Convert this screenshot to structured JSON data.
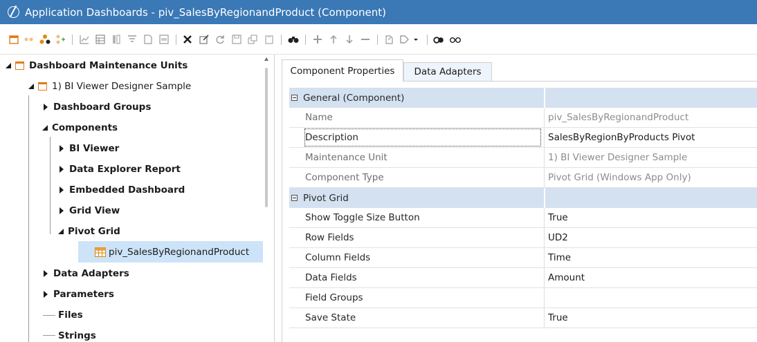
{
  "window": {
    "title": "Application Dashboards - piv_SalesByRegionandProduct (Component)"
  },
  "toolbar": {
    "icons": [
      "create-dashboard-icon",
      "link-icon",
      "group-icon",
      "add-component-icon",
      "chart-icon",
      "table-icon",
      "columns-icon",
      "filter-icon",
      "document-icon",
      "window-icon",
      "delete-icon",
      "rename-icon",
      "refresh-icon",
      "save-icon",
      "copy-icon",
      "paste-icon",
      "search-icon",
      "add-icon",
      "move-up-icon",
      "move-down-icon",
      "remove-icon",
      "open-icon",
      "run-icon",
      "find-icon",
      "view-icon"
    ]
  },
  "tree": {
    "root": "Dashboard Maintenance Units",
    "unit": "1) BI Viewer Designer Sample",
    "dashboard_groups": "Dashboard Groups",
    "components": "Components",
    "bi_viewer": "BI Viewer",
    "data_explorer": "Data Explorer Report",
    "embedded": "Embedded Dashboard",
    "grid_view": "Grid View",
    "pivot_grid": "Pivot Grid",
    "selected_item": "piv_SalesByRegionandProduct",
    "data_adapters": "Data Adapters",
    "parameters": "Parameters",
    "files": "Files",
    "strings": "Strings"
  },
  "tabs": {
    "properties": "Component Properties",
    "adapters": "Data Adapters"
  },
  "properties": {
    "general_category": "General (Component)",
    "pivot_category": "Pivot Grid",
    "rows": [
      {
        "name": "Name",
        "value": "piv_SalesByRegionandProduct"
      },
      {
        "name": "Description",
        "value": "SalesByRegionByProducts Pivot"
      },
      {
        "name": "Maintenance Unit",
        "value": "1) BI Viewer Designer Sample"
      },
      {
        "name": "Component Type",
        "value": "Pivot Grid (Windows App Only)"
      },
      {
        "name": "Show Toggle Size Button",
        "value": "True"
      },
      {
        "name": "Row Fields",
        "value": "UD2"
      },
      {
        "name": "Column Fields",
        "value": "Time"
      },
      {
        "name": "Data Fields",
        "value": "Amount"
      },
      {
        "name": "Field Groups",
        "value": ""
      },
      {
        "name": "Save State",
        "value": "True"
      }
    ]
  },
  "colors": {
    "titlebar": "#3a78b6",
    "category_band": "#d3e1f0",
    "selection": "#cde3f7",
    "folder_accent": "#e07b16"
  }
}
